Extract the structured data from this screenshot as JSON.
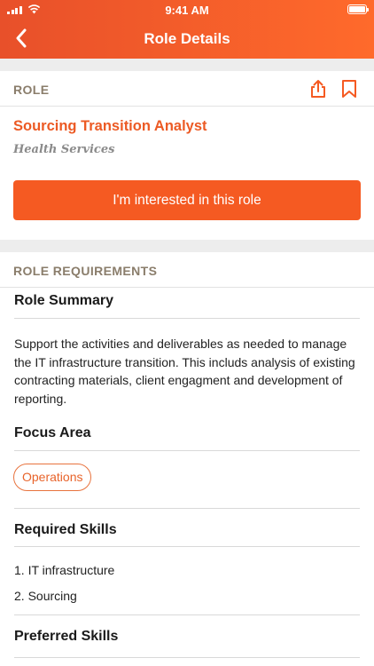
{
  "status_bar": {
    "time": "9:41 AM"
  },
  "nav": {
    "title": "Role Details"
  },
  "role_section": {
    "label": "ROLE",
    "title": "Sourcing Transition Analyst",
    "company": "Health Services",
    "cta_label": "I'm interested in this role"
  },
  "requirements": {
    "label": "ROLE REQUIREMENTS",
    "summary_heading": "Role Summary",
    "summary_text": "Support the activities and deliverables as needed to manage the IT infrastructure transition. This includs analysis of existing contracting materials, client engagment and development of reporting.",
    "focus_heading": "Focus Area",
    "focus_tags": [
      "Operations"
    ],
    "required_heading": "Required Skills",
    "required_skills": [
      "1. IT infrastructure",
      "2. Sourcing"
    ],
    "preferred_heading": "Preferred Skills"
  },
  "colors": {
    "accent": "#f55a22",
    "header_gradient_start": "#e8502a",
    "header_gradient_end": "#ff6a2b",
    "section_label": "#8a7d6b"
  },
  "icons": {
    "back": "chevron-left-icon",
    "share": "share-icon",
    "bookmark": "bookmark-icon"
  }
}
